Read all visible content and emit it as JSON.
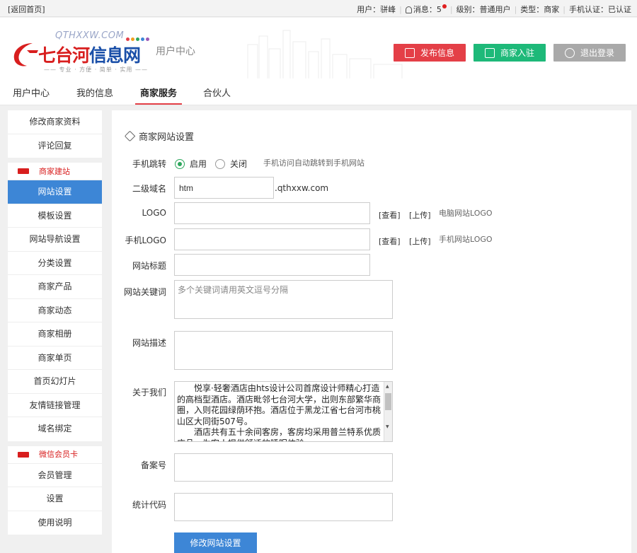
{
  "topbar": {
    "back": "[返回首页]",
    "user": "用户：骈峰",
    "messages": "消息：5",
    "level": "级别：普通用户",
    "type": "类型：商家",
    "mobile_verify": "手机认证：已认证"
  },
  "header": {
    "logo_domain": "QTHXXW.COM",
    "logo_brand_red": "七台河",
    "logo_brand_blue": "信息网",
    "logo_slogan": "—— 专业 · 方便 · 简单 · 实用 ——",
    "subtitle": "用户中心",
    "btn_post": "发布信息",
    "btn_merchant": "商家入驻",
    "btn_logout": "退出登录",
    "colors": {
      "post": "#e43f47",
      "merchant": "#1eb979",
      "logout": "#a9a9a9",
      "accent": "#3d86d6"
    }
  },
  "nav": {
    "tabs": [
      "用户中心",
      "我的信息",
      "商家服务",
      "合伙人"
    ],
    "active": "商家服务"
  },
  "sidebar": {
    "group1": [
      "修改商家资料",
      "评论回复"
    ],
    "group2_head": "商家建站",
    "group2": [
      "网站设置",
      "模板设置",
      "网站导航设置",
      "分类设置",
      "商家产品",
      "商家动态",
      "商家相册",
      "商家单页",
      "首页幻灯片",
      "友情链接管理",
      "域名绑定"
    ],
    "group3_head": "微信会员卡",
    "group3": [
      "会员管理",
      "设置",
      "使用说明"
    ]
  },
  "form": {
    "title": "商家网站设置",
    "mobile_jump_label": "手机跳转",
    "radio_on": "启用",
    "radio_off": "关闭",
    "mobile_jump_hint": "手机访问自动跳转到手机网站",
    "subdomain_label": "二级域名",
    "subdomain_value": "htm",
    "subdomain_suffix": ".qthxxw.com",
    "logo_label": "LOGO",
    "view": "[查看]",
    "upload": "[上传]",
    "logo_hint": "电脑网站LOGO",
    "mlogo_label": "手机LOGO",
    "mlogo_hint": "手机网站LOGO",
    "site_title_label": "网站标题",
    "keywords_label": "网站关键词",
    "keywords_placeholder": "多个关键词请用英文逗号分隔",
    "desc_label": "网站描述",
    "about_label": "关于我们",
    "about_p1": "悦享·轻奢酒店由hts设计公司首席设计师精心打造的高档型酒店。酒店毗邻七台河大学，出则东部繁华商圈，入则花园绿荫环抱。酒店位于黑龙江省七台河市桃山区大同街507号。",
    "about_p2": "酒店共有五十余间客房，客房均采用普兰特系优质床品，为客人提供舒适的睡眠体验。",
    "icp_label": "备案号",
    "stats_label": "统计代码",
    "submit": "修改网站设置"
  }
}
